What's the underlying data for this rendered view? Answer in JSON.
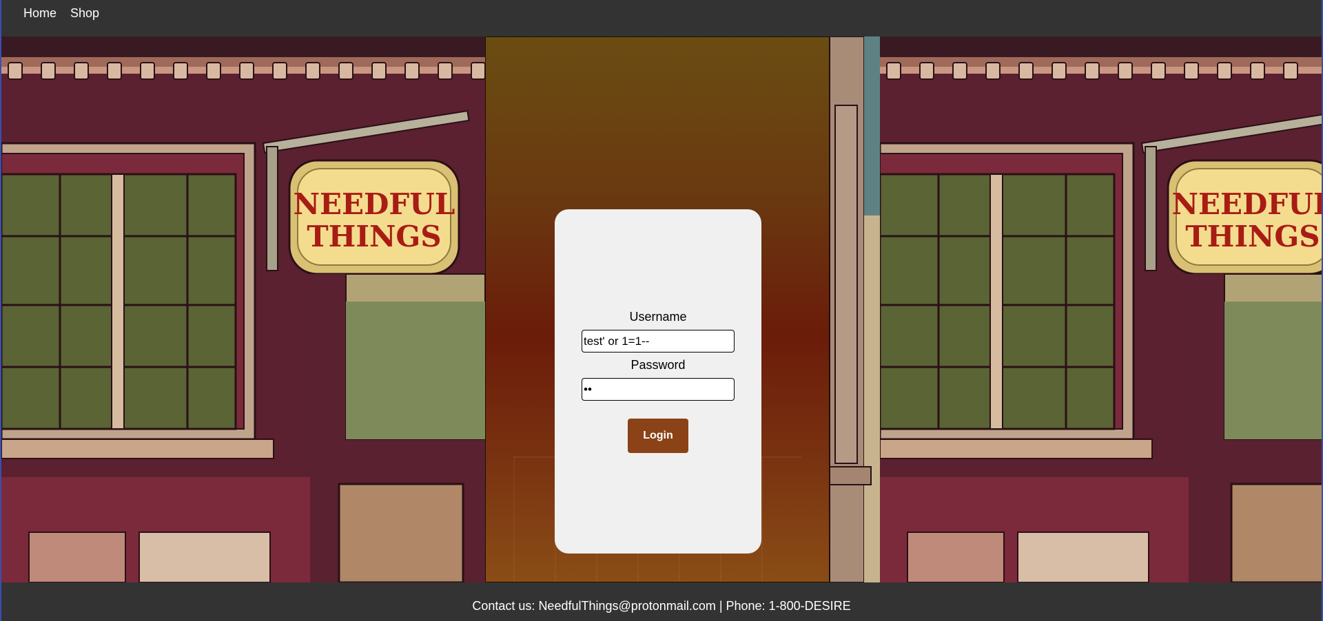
{
  "nav": {
    "items": [
      {
        "label": "Home"
      },
      {
        "label": "Shop"
      }
    ]
  },
  "storefront": {
    "sign_line1": "NEEDFUL",
    "sign_line2": "THINGS"
  },
  "login": {
    "username_label": "Username",
    "username_value": "test' or 1=1--",
    "password_label": "Password",
    "password_value": "ab",
    "button_label": "Login"
  },
  "footer": {
    "text": "Contact us: NeedfulThings@protonmail.com | Phone: 1-800-DESIRE"
  },
  "colors": {
    "nav_bg": "#333333",
    "button_bg": "#8a4216",
    "card_bg": "#f0f0f0",
    "wall": "#5d2231",
    "sign_bg": "#f4dc8e",
    "sign_text": "#a81c14"
  }
}
